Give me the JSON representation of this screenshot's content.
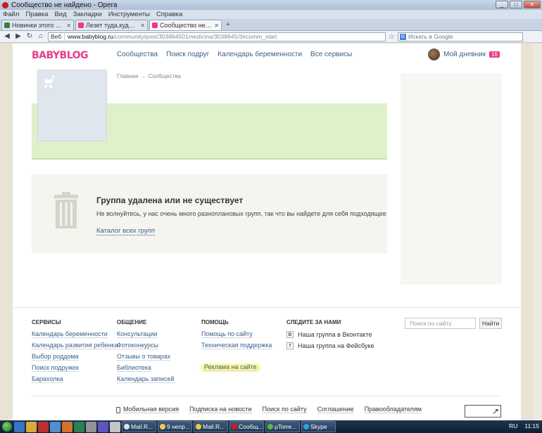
{
  "window": {
    "title": "Сообщество не найдено - Opera",
    "controls": [
      "_",
      "□",
      "✕"
    ]
  },
  "menu": [
    "Файл",
    "Правка",
    "Вид",
    "Закладки",
    "Инструменты",
    "Справка"
  ],
  "tabs": [
    {
      "label": "Новинки этого сезона...",
      "color": "#3a7d3a"
    },
    {
      "label": "Лезет туда,куда не про...",
      "color": "#ea3a8a"
    },
    {
      "label": "Сообщество не найде...",
      "color": "#ea3a8a"
    }
  ],
  "address": {
    "web_label": "Веб",
    "domain": "www.babyblog.ru",
    "path": "/community/post/303864501medicina/3038645/3#comm_start",
    "search_placeholder": "Искать в Google"
  },
  "site": {
    "logo": "BABYBLOG",
    "nav": [
      "Сообщества",
      "Поиск подруг",
      "Календарь беременности",
      "Все сервисы"
    ],
    "diary_label": "Мой дневник",
    "diary_count": "16",
    "breadcrumbs": [
      "Главная",
      "→",
      "Сообщества"
    ]
  },
  "notice": {
    "title": "Группа удалена или не существует",
    "text": "Не волнуйтесь, у нас очень много разноплановых групп, так что  вы найдете для себя подходящее",
    "link": "Каталог всех групп"
  },
  "footer": {
    "columns": [
      {
        "heading": "СЕРВИСЫ",
        "links": [
          "Календарь беременности",
          "Календарь развития ребенка",
          "Выбор роддома",
          "Поиск подружек",
          "Барахолка"
        ]
      },
      {
        "heading": "ОБЩЕНИЕ",
        "links": [
          "Консультации",
          "Фотоконкурсы",
          "Отзывы о товарах",
          "Библиотека",
          "Календарь записей"
        ]
      },
      {
        "heading": "ПОМОЩЬ",
        "links": [
          "Помощь по сайту",
          "Техническая поддержка",
          "Реклама на сайте"
        ]
      }
    ],
    "follow": {
      "heading": "СЛЕДИТЕ ЗА НАМИ",
      "items": [
        {
          "icon": "В",
          "label": "Наша группа в Вконтакте"
        },
        {
          "icon": "f",
          "label": "Наша группа на Фейсбуке"
        }
      ]
    },
    "search_placeholder": "Поиск по сайту",
    "search_button": "Найти",
    "bottom_links": [
      "Мобильная версия",
      "Подписка на новости",
      "Поиск по сайту",
      "Соглашение",
      "Правообладателям"
    ]
  },
  "taskbar": {
    "buttons": [
      {
        "label": "Mail.R...",
        "color": "#e2e2e2"
      },
      {
        "label": "9 непр...",
        "color": "#f2c94c"
      },
      {
        "label": "Mail.R...",
        "color": "#f2c94c"
      },
      {
        "label": "Сообщ...",
        "color": "#d0191f"
      },
      {
        "label": "µTorre...",
        "color": "#57b947"
      },
      {
        "label": "Skype",
        "color": "#2ba4e0"
      }
    ],
    "lang": "RU",
    "time": "11:15"
  }
}
